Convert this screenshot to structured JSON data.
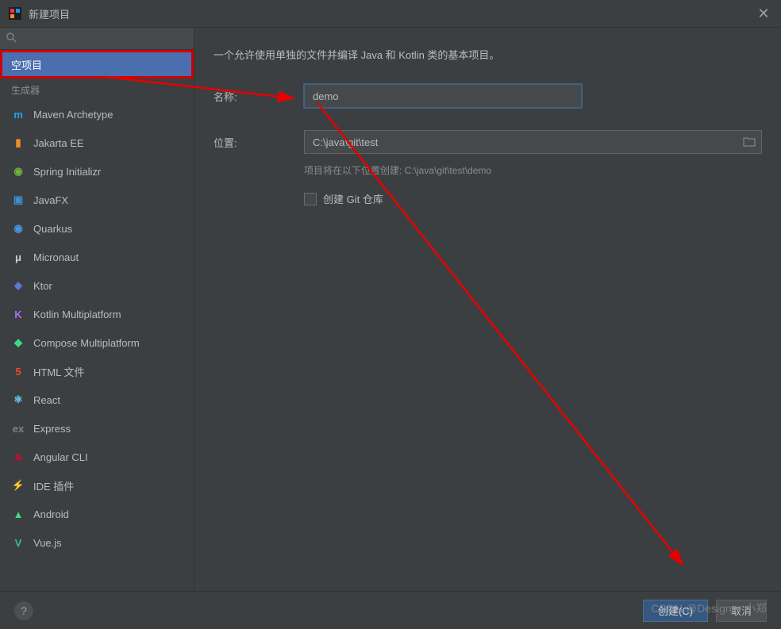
{
  "title": "新建项目",
  "sidebar": {
    "selected": "空项目",
    "generators_label": "生成器",
    "items": [
      {
        "label": "Maven Archetype",
        "icon": "m",
        "color": "#21a0f0"
      },
      {
        "label": "Jakarta EE",
        "icon": "▮",
        "color": "#f28c26"
      },
      {
        "label": "Spring Initializr",
        "icon": "◉",
        "color": "#6db33f"
      },
      {
        "label": "JavaFX",
        "icon": "▣",
        "color": "#3d8ed0"
      },
      {
        "label": "Quarkus",
        "icon": "◉",
        "color": "#4695eb"
      },
      {
        "label": "Micronaut",
        "icon": "μ",
        "color": "#cfcfcf"
      },
      {
        "label": "Ktor",
        "icon": "◆",
        "color": "#5c79d6"
      },
      {
        "label": "Kotlin Multiplatform",
        "icon": "K",
        "color": "#a96cf5"
      },
      {
        "label": "Compose Multiplatform",
        "icon": "◆",
        "color": "#3ddc84"
      },
      {
        "label": "HTML 文件",
        "icon": "5",
        "color": "#e44d26"
      },
      {
        "label": "React",
        "icon": "⚛",
        "color": "#61dafb"
      },
      {
        "label": "Express",
        "icon": "ex",
        "color": "#828282"
      },
      {
        "label": "Angular CLI",
        "icon": "A",
        "color": "#dd0031"
      },
      {
        "label": "IDE 插件",
        "icon": "⚡",
        "color": "#9a9a9a"
      },
      {
        "label": "Android",
        "icon": "▲",
        "color": "#3ddc84"
      },
      {
        "label": "Vue.js",
        "icon": "V",
        "color": "#41b883"
      }
    ]
  },
  "main": {
    "description": "一个允许使用单独的文件并编译 Java 和 Kotlin 类的基本项目。",
    "name_label": "名称:",
    "name_value": "demo",
    "location_label": "位置:",
    "location_value": "C:\\java\\git\\test",
    "location_hint_prefix": "项目将在以下位置创建: ",
    "location_hint_path": "C:\\java\\git\\test\\demo",
    "git_checkbox_label": "创建 Git 仓库"
  },
  "footer": {
    "create": "创建(C)",
    "cancel": "取消"
  },
  "watermark": "CSDN @Designer 小郑"
}
